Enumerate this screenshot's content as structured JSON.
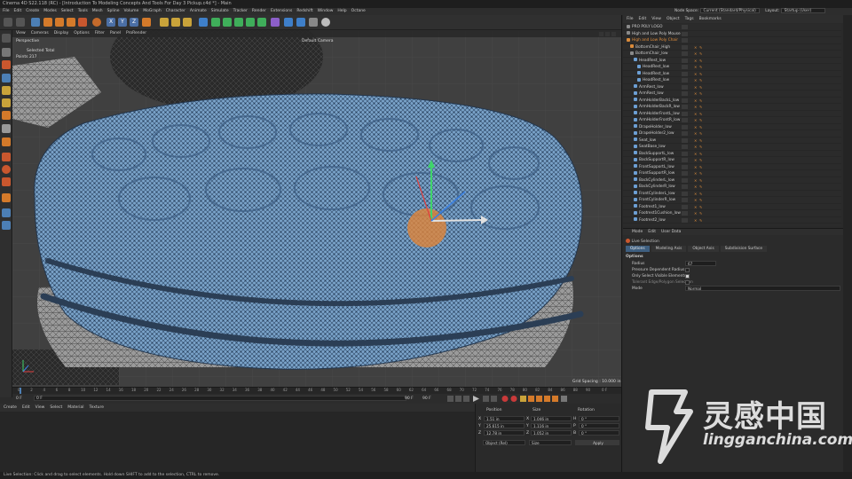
{
  "window": {
    "title": "Cinema 4D S22.118 (RC) - [Introduction To Modeling Concepts And Tools For Day 3 Pickup.c4d *] - Main",
    "node_space_label": "Node Space:",
    "node_space_value": "Current (Standard/Physical)",
    "layout_label": "Layout:",
    "layout_value": "Startup (User)"
  },
  "menubar": [
    "File",
    "Edit",
    "Create",
    "Modes",
    "Select",
    "Tools",
    "Mesh",
    "Spline",
    "Volume",
    "MoGraph",
    "Character",
    "Animate",
    "Simulate",
    "Tracker",
    "Render",
    "Extensions",
    "Redshift",
    "Window",
    "Help",
    "Octane"
  ],
  "viewport": {
    "menu": [
      "View",
      "Cameras",
      "Display",
      "Options",
      "Filter",
      "Panel",
      "ProRender"
    ],
    "label": "Perspective",
    "camera": "Default Camera",
    "selected_label": "Selected Total",
    "points_label": "Points  217",
    "grid_spacing": "Grid Spacing : 10.000 in"
  },
  "timeline": {
    "ticks": [
      "0",
      "2",
      "4",
      "6",
      "8",
      "10",
      "12",
      "14",
      "16",
      "18",
      "20",
      "22",
      "24",
      "26",
      "28",
      "30",
      "32",
      "34",
      "36",
      "38",
      "40",
      "42",
      "44",
      "46",
      "48",
      "50",
      "52",
      "54",
      "56",
      "58",
      "60",
      "62",
      "64",
      "66",
      "68",
      "70",
      "72",
      "74",
      "76",
      "78",
      "80",
      "82",
      "84",
      "86",
      "88",
      "90"
    ],
    "end_frame": "0 F"
  },
  "transport": {
    "start": "0 F",
    "current": "0 F",
    "min": "90 F",
    "max": "90 F"
  },
  "material_manager": {
    "menu": [
      "Create",
      "Edit",
      "View",
      "Select",
      "Material",
      "Texture"
    ]
  },
  "coordinates": {
    "headers": [
      "Position",
      "Size",
      "Rotation"
    ],
    "rows": [
      {
        "axis": "X",
        "pos": "1.51 in",
        "size_axis": "X",
        "size": "1.046 in",
        "rot_axis": "H",
        "rot": "0 °"
      },
      {
        "axis": "Y",
        "pos": "25.615 in",
        "size_axis": "Y",
        "size": "1.116 in",
        "rot_axis": "P",
        "rot": "0 °"
      },
      {
        "axis": "Z",
        "pos": "12.78 in",
        "size_axis": "Z",
        "size": "1.052 in",
        "rot_axis": "B",
        "rot": "0 °"
      }
    ],
    "mode": "Object (Rel)",
    "size_mode": "Size",
    "apply": "Apply"
  },
  "object_manager": {
    "menu": [
      "File",
      "Edit",
      "View",
      "Object",
      "Tags",
      "Bookmarks"
    ],
    "objects": [
      {
        "name": "PRO POLY LOGO",
        "indent": 0,
        "color": "#8a8a8a"
      },
      {
        "name": "High and Low Poly Mouse",
        "indent": 0,
        "color": "#8a8a8a"
      },
      {
        "name": "High and Low Poly Chair",
        "indent": 0,
        "color": "#d98a3a"
      },
      {
        "name": "BottomChair_High",
        "indent": 1,
        "color": "#d98a3a"
      },
      {
        "name": "BottomChair_low",
        "indent": 1,
        "color": "#8a8a8a"
      },
      {
        "name": "HeadRest_low",
        "indent": 2,
        "color": "#6c9fd4"
      },
      {
        "name": "HeadRest_low",
        "indent": 3,
        "color": "#6c9fd4"
      },
      {
        "name": "HeadRest_low",
        "indent": 3,
        "color": "#6c9fd4"
      },
      {
        "name": "HeadRest_low",
        "indent": 3,
        "color": "#6c9fd4"
      },
      {
        "name": "ArmRest_low",
        "indent": 2,
        "color": "#6c9fd4"
      },
      {
        "name": "ArmRest_low",
        "indent": 2,
        "color": "#6c9fd4"
      },
      {
        "name": "ArmHolderBackL_low",
        "indent": 2,
        "color": "#6c9fd4"
      },
      {
        "name": "ArmHolderBackR_low",
        "indent": 2,
        "color": "#6c9fd4"
      },
      {
        "name": "ArmHolderFrontL_low",
        "indent": 2,
        "color": "#6c9fd4"
      },
      {
        "name": "ArmHolderFrontR_low",
        "indent": 2,
        "color": "#6c9fd4"
      },
      {
        "name": "DrapeHolder_low",
        "indent": 2,
        "color": "#6c9fd4"
      },
      {
        "name": "DrapeHolder2_low",
        "indent": 2,
        "color": "#6c9fd4"
      },
      {
        "name": "Seat_low",
        "indent": 2,
        "color": "#6c9fd4"
      },
      {
        "name": "SeatBase_low",
        "indent": 2,
        "color": "#6c9fd4"
      },
      {
        "name": "BackSupportL_low",
        "indent": 2,
        "color": "#6c9fd4"
      },
      {
        "name": "BackSupportR_low",
        "indent": 2,
        "color": "#6c9fd4"
      },
      {
        "name": "FrontSupportL_low",
        "indent": 2,
        "color": "#6c9fd4"
      },
      {
        "name": "FrontSupportR_low",
        "indent": 2,
        "color": "#6c9fd4"
      },
      {
        "name": "BackCylinderL_low",
        "indent": 2,
        "color": "#6c9fd4"
      },
      {
        "name": "BackCylinderR_low",
        "indent": 2,
        "color": "#6c9fd4"
      },
      {
        "name": "FrontCylinderL_low",
        "indent": 2,
        "color": "#6c9fd4"
      },
      {
        "name": "FrontCylinderR_low",
        "indent": 2,
        "color": "#6c9fd4"
      },
      {
        "name": "Footrest1_low",
        "indent": 2,
        "color": "#6c9fd4"
      },
      {
        "name": "Footrest1Cushion_low",
        "indent": 2,
        "color": "#6c9fd4"
      },
      {
        "name": "Footrest2_low",
        "indent": 2,
        "color": "#6c9fd4"
      }
    ]
  },
  "attributes": {
    "menu": [
      "Mode",
      "Edit",
      "User Data"
    ],
    "tool_name": "Live Selection",
    "tabs": [
      "Options",
      "Modeling Axis",
      "Object Axis",
      "Subdivision Surface"
    ],
    "section": "Options",
    "radius_label": "Radius",
    "radius_value": "67",
    "pressure_label": "Pressure Dependent Radius",
    "visible_label": "Only Select Visible Elements",
    "tolerant_label": "Tolerant Edge/Polygon Selection",
    "mode_label": "Mode",
    "mode_value": "Normal"
  },
  "status": "Live Selection: Click and drag to select elements. Hold down SHIFT to add to the selection, CTRL to remove.",
  "watermark": {
    "cn": "灵感中国",
    "en": "lingganchina.com"
  }
}
